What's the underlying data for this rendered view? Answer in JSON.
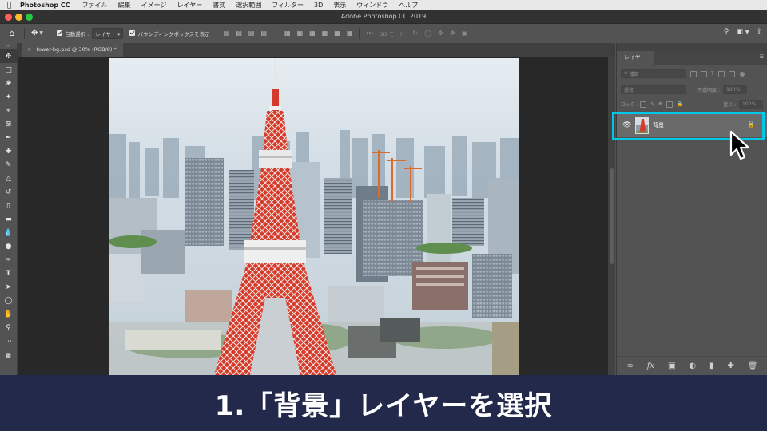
{
  "menubar": {
    "apple_icon": "apple-icon",
    "app_name": "Photoshop CC",
    "items": [
      "ファイル",
      "編集",
      "イメージ",
      "レイヤー",
      "書式",
      "選択範囲",
      "フィルター",
      "3D",
      "表示",
      "ウィンドウ",
      "ヘルプ"
    ]
  },
  "window": {
    "title": "Adobe Photoshop CC 2019"
  },
  "options_bar": {
    "auto_select_label": "自動選択 :",
    "auto_select_value": "レイヤー",
    "bounding_box_label": "バウンディングボックスを表示",
    "mode_3d_label": "3D モード :"
  },
  "document": {
    "tab_label": "tower-bg.psd @ 30% (RGB/8) *"
  },
  "layers_panel": {
    "tab_label": "レイヤー",
    "kind_placeholder": "種類",
    "blend_mode": "通常",
    "opacity_label": "不透明度 :",
    "opacity_value": "100%",
    "lock_label": "ロック :",
    "fill_label": "塗り :",
    "fill_value": "100%",
    "layers": [
      {
        "name": "背景",
        "visible": true,
        "locked": true,
        "selected": true
      }
    ]
  },
  "caption": {
    "text": "1.「背景」レイヤーを選択"
  },
  "colors": {
    "highlight": "#00c8e8",
    "caption_bg": "#22294a",
    "ui_panel": "#535353",
    "canvas_bg": "#282828"
  }
}
